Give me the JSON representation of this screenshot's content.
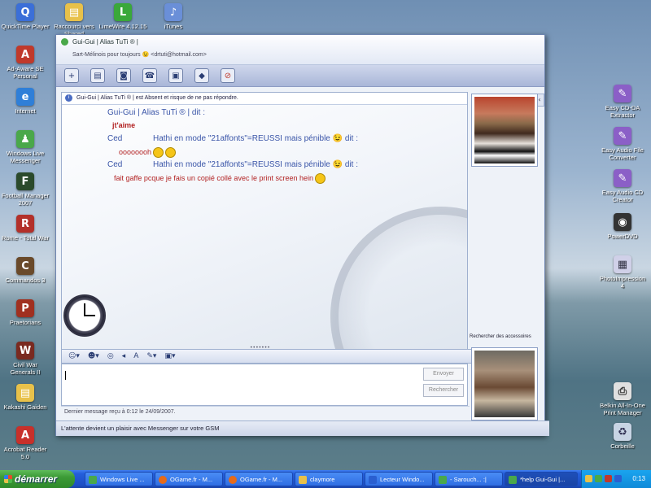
{
  "desktop": {
    "icons": [
      {
        "label": "QuickTime Player",
        "color": "#3b6fd8",
        "glyph": "Q"
      },
      {
        "label": "Raccourci vers Shared",
        "color": "#e8c14a",
        "glyph": "▤"
      },
      {
        "label": "LimeWire 4.12.15",
        "color": "#3aa83a",
        "glyph": "L"
      },
      {
        "label": "iTunes",
        "color": "#6a8fd8",
        "glyph": "♪"
      },
      {
        "label": "Ad-Aware SE Personal",
        "color": "#c0392b",
        "glyph": "A"
      },
      {
        "label": "Internet",
        "color": "#2f7fd8",
        "glyph": "e"
      },
      {
        "label": "Windows Live Messenger",
        "color": "#4aa84a",
        "glyph": "♟"
      },
      {
        "label": "Football Manager 2007",
        "color": "#2b4a2b",
        "glyph": "F"
      },
      {
        "label": "Rome - Total War",
        "color": "#b3302a",
        "glyph": "R"
      },
      {
        "label": "Commandos 3",
        "color": "#6a4a2a",
        "glyph": "C"
      },
      {
        "label": "Praetorians",
        "color": "#a03020",
        "glyph": "P"
      },
      {
        "label": "Civil War Generals II",
        "color": "#7a2a20",
        "glyph": "W"
      },
      {
        "label": "Kakashi Gaiden",
        "color": "#e8c14a",
        "glyph": "▤"
      },
      {
        "label": "Acrobat Reader 5.0",
        "color": "#c8302a",
        "glyph": "A"
      },
      {
        "label": "Easy CD-DA Extractor",
        "color": "#8b5fc7",
        "glyph": "✎"
      },
      {
        "label": "Easy Audio File Converter",
        "color": "#8b5fc7",
        "glyph": "✎"
      },
      {
        "label": "Easy Audio CD Creator",
        "color": "#8b5fc7",
        "glyph": "✎"
      },
      {
        "label": "PowerDVD",
        "color": "#333333",
        "glyph": "◉"
      },
      {
        "label": "PhotoImpression 4",
        "color": "#d0d0e8",
        "glyph": "▦"
      },
      {
        "label": "Belkin All-In-One Print Manager",
        "color": "#e0e0e0",
        "glyph": "⎙"
      },
      {
        "label": "Corbeille",
        "color": "#c8d4e4",
        "glyph": "♻"
      }
    ]
  },
  "window": {
    "title": "Gui-Gui | Alias TuTi ® |",
    "subtitle": "Sart-Mélinois pour toujours 😉 <drtuti@hotmail.com>",
    "toolbar_icons": [
      "invite-icon",
      "send-file-icon",
      "video-icon",
      "call-icon",
      "activities-icon",
      "games-icon",
      "block-icon"
    ],
    "notice": "Gui-Gui | Alias TuTi ® | est Absent et risque de ne pas répondre.",
    "messages": [
      {
        "type": "header",
        "text": "Gui-Gui | Alias TuTi ® | dit :"
      },
      {
        "type": "msg",
        "text": "jt'aime"
      },
      {
        "type": "header",
        "sender": "Ced",
        "text": "Hathi en mode \"21affonts\"=REUSSI mais pénible 😉 dit :"
      },
      {
        "type": "msg",
        "text": "oooooooh"
      },
      {
        "type": "header",
        "sender": "Ced",
        "text": "Hathi en mode \"21affonts\"=REUSSI mais pénible 😉 dit :"
      },
      {
        "type": "msg",
        "text": "fait gaffe pcque je fais un copié collé avec le print screen hein"
      }
    ],
    "input_placeholder": "",
    "send_button": "Envoyer",
    "search_button": "Rechercher",
    "status": "Dernier message reçu à 0:12 le 24/09/2007.",
    "footer": "L'attente devient un plaisir avec Messenger sur votre GSM",
    "accessories_label": "Rechercher des accessoires"
  },
  "taskbar": {
    "start_label": "démarrer",
    "tasks": [
      {
        "label": "Windows Live ...",
        "color": "#4aa84a"
      },
      {
        "label": "OGame.fr - M...",
        "color": "#e66a1a"
      },
      {
        "label": "OGame.fr - M...",
        "color": "#e66a1a"
      },
      {
        "label": "claymore",
        "color": "#e8c14a"
      },
      {
        "label": "Lecteur Windo...",
        "color": "#2a5fd0"
      },
      {
        "label": "- Sarouch... :|",
        "color": "#4aa84a"
      },
      {
        "label": "*help Gui-Gui |...",
        "color": "#4aa84a"
      }
    ],
    "clock": "0:13",
    "tray_colors": [
      "#e8c14a",
      "#4aa84a",
      "#c0392b",
      "#2a5fd0"
    ]
  }
}
